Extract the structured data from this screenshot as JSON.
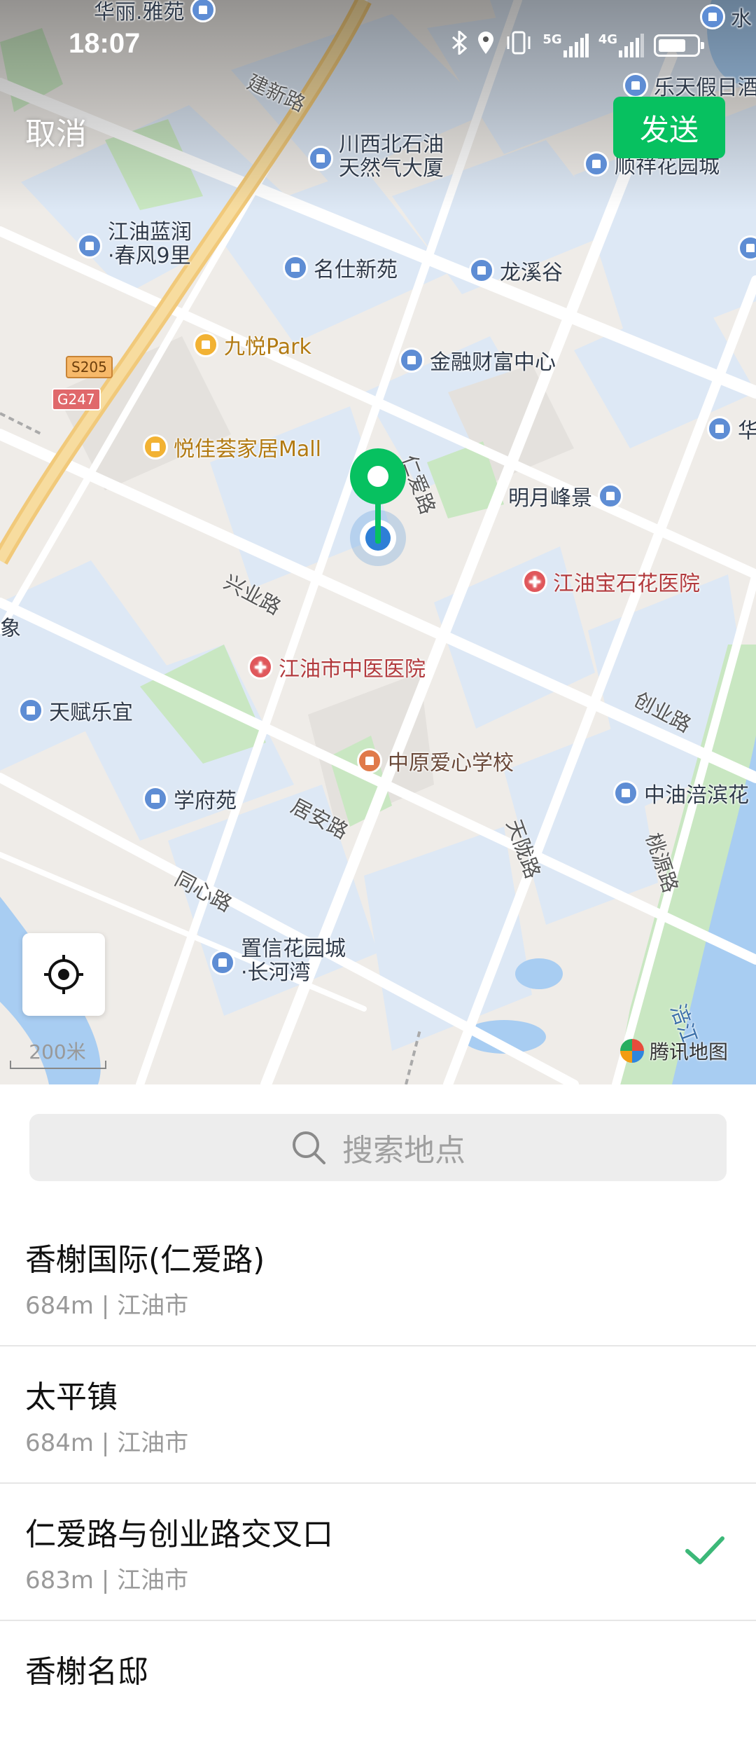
{
  "status_bar": {
    "time": "18:07",
    "icons": [
      "bluetooth-icon",
      "location-icon",
      "vibrate-icon",
      "5g-signal-icon",
      "4g-signal-icon",
      "battery-icon"
    ],
    "net1": "5G",
    "net2": "4G"
  },
  "header": {
    "cancel_label": "取消",
    "send_label": "发送",
    "send_color": "#07c160"
  },
  "map": {
    "pois": {
      "p_huali": "华丽.雅苑",
      "p_shui": "水",
      "p_letian": "乐天假日酒",
      "p_chuanxi": "川西北石油\n天然气大厦",
      "p_shunxiang": "顺祥花园城",
      "p_lanrun": "江油蓝润\n·春风9里",
      "p_mingshi": "名仕新苑",
      "p_longxi": "龙溪谷",
      "p_jiuyue": "九悦Park",
      "p_jinrong": "金融财富中心",
      "p_hua": "华",
      "p_yuejia": "悦佳荟家居Mall",
      "p_mingyue": "明月峰景",
      "p_baoshi": "江油宝石花医院",
      "p_zhongyi": "江油市中医医院",
      "p_xiang": "象",
      "p_tianfu": "天赋乐宜",
      "p_zhongyuan": "中原爱心学校",
      "p_xuefu": "学府苑",
      "p_zhongyou": "中油涪滨花",
      "p_zhixin": "置信花园城\n·长河湾"
    },
    "roads": {
      "r_jianxin": "建新路",
      "r_renai": "仁爱路",
      "r_xingye": "兴业路",
      "r_chuangye": "创业路",
      "r_juan": "居安路",
      "r_tianlong": "天陇路",
      "r_taoyuan": "桃源路",
      "r_tongxin": "同心路",
      "r_fujiang": "涪江"
    },
    "shields": {
      "s205": "S205",
      "g247": "G247"
    },
    "scale_label": "200米",
    "brand_label": "腾讯地图",
    "marker_color": "#07c160",
    "location_color": "#2e7fd6"
  },
  "search": {
    "placeholder": "搜索地点"
  },
  "results": [
    {
      "title": "香榭国际(仁爱路)",
      "subtitle": "684m | 江油市",
      "selected": false
    },
    {
      "title": "太平镇",
      "subtitle": "684m | 江油市",
      "selected": false
    },
    {
      "title": "仁爱路与创业路交叉口",
      "subtitle": "683m | 江油市",
      "selected": true
    },
    {
      "title": "香榭名邸",
      "subtitle": "",
      "selected": false
    }
  ],
  "colors": {
    "accent": "#07c160",
    "check": "#3cb878"
  }
}
